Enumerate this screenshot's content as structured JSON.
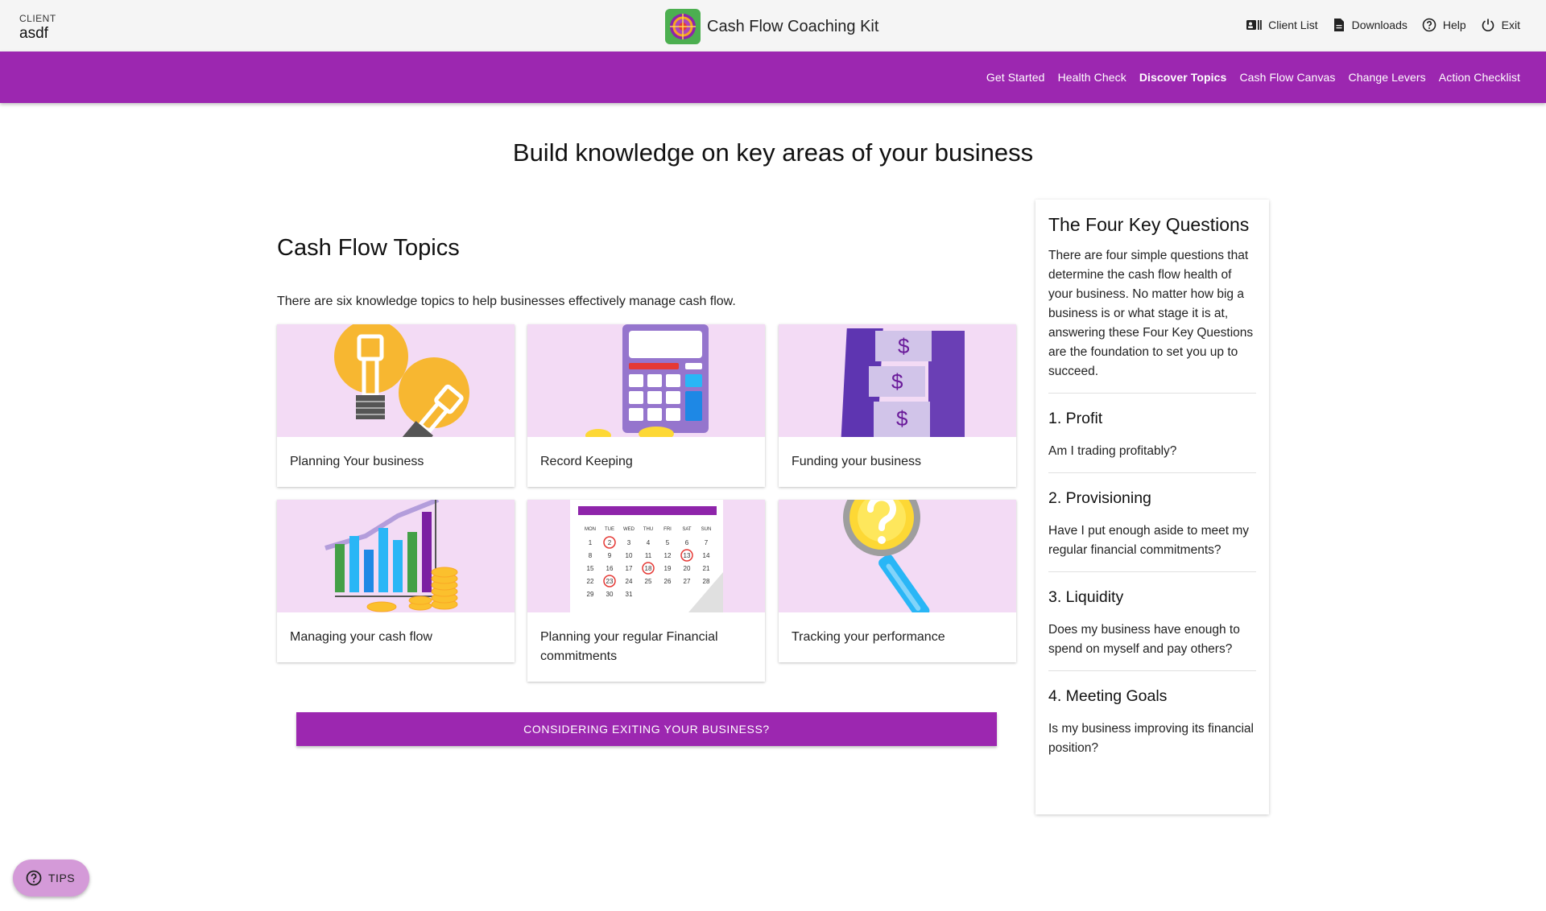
{
  "header": {
    "client_label": "CLIENT",
    "client_name": "asdf",
    "app_title": "Cash Flow Coaching Kit",
    "actions": [
      {
        "label": "Client List",
        "icon": "client-list-icon"
      },
      {
        "label": "Downloads",
        "icon": "document-icon"
      },
      {
        "label": "Help",
        "icon": "help-icon"
      },
      {
        "label": "Exit",
        "icon": "power-icon"
      }
    ]
  },
  "nav": {
    "items": [
      {
        "label": "Get Started"
      },
      {
        "label": "Health Check"
      },
      {
        "label": "Discover Topics",
        "active": true
      },
      {
        "label": "Cash Flow Canvas"
      },
      {
        "label": "Change Levers"
      },
      {
        "label": "Action Checklist"
      }
    ]
  },
  "main": {
    "heading": "Build knowledge on key areas of your business",
    "topics_title": "Cash Flow Topics",
    "topics_intro": "There are six knowledge topics to help businesses effectively manage cash flow.",
    "cards": [
      {
        "label": "Planning Your business",
        "image": "lightbulbs-illustration"
      },
      {
        "label": "Record Keeping",
        "image": "calculator-illustration"
      },
      {
        "label": "Funding your business",
        "image": "money-stacks-illustration"
      },
      {
        "label": "Managing your cash flow",
        "image": "bar-chart-coins-illustration"
      },
      {
        "label": "Planning your regular Financial commitments",
        "image": "calendar-illustration"
      },
      {
        "label": "Tracking your performance",
        "image": "magnifier-illustration"
      }
    ],
    "exit_button": "CONSIDERING EXITING YOUR BUSINESS?"
  },
  "panel": {
    "title": "The Four Key Questions",
    "intro": "There are four simple questions that determine the cash flow health of your business. No matter how big a business is or what stage it is at, answering these Four Key Questions are the foundation to set you up to succeed.",
    "questions": [
      {
        "title": "1. Profit",
        "text": "Am I trading profitably?"
      },
      {
        "title": "2. Provisioning",
        "text": "Have I put enough aside to meet my regular financial commitments?"
      },
      {
        "title": "3. Liquidity",
        "text": "Does my business have enough to spend on myself and pay others?"
      },
      {
        "title": "4. Meeting Goals",
        "text": "Is my business improving its financial position?"
      }
    ]
  },
  "tips": {
    "label": "TIPS",
    "icon": "help-icon"
  },
  "colors": {
    "accent": "#9c27b0",
    "card_bg": "#f3dbf5",
    "tips_bg": "#d49ad8"
  },
  "calendar": {
    "days": [
      "MON",
      "TUE",
      "WED",
      "THU",
      "FRI",
      "SAT",
      "SUN"
    ],
    "rows": [
      [
        "1",
        "2",
        "3",
        "4",
        "5",
        "6",
        "7"
      ],
      [
        "8",
        "9",
        "10",
        "11",
        "12",
        "13",
        "14"
      ],
      [
        "15",
        "16",
        "17",
        "18",
        "19",
        "20",
        "21"
      ],
      [
        "22",
        "23",
        "24",
        "25",
        "26",
        "27",
        "28"
      ],
      [
        "29",
        "30",
        "31",
        "",
        "",
        "",
        ""
      ]
    ]
  }
}
